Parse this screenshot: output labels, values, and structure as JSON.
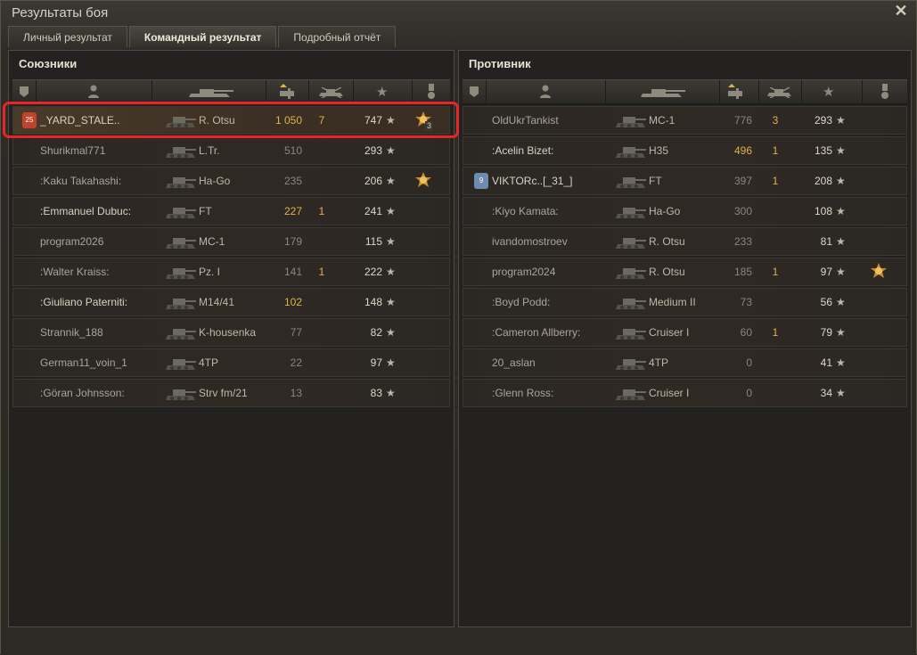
{
  "window": {
    "title": "Результаты боя"
  },
  "tabs": [
    {
      "label": "Личный результат"
    },
    {
      "label": "Командный результат"
    },
    {
      "label": "Подробный отчёт"
    }
  ],
  "allies": {
    "title": "Союзники",
    "rows": [
      {
        "name": "_YARD_STALE..",
        "clan_badge": "25",
        "vehicle": "R. Otsu",
        "damage": "1 050",
        "kills": "7",
        "xp": "747",
        "medal": true,
        "medal_count": "3",
        "self": true,
        "alive": true
      },
      {
        "name": "Shurikmal771",
        "vehicle": "L.Tr.",
        "damage": "510",
        "kills": "",
        "xp": "293",
        "medal": false,
        "alive": false
      },
      {
        "name": ":Kaku Takahashi:",
        "vehicle": "Ha-Go",
        "damage": "235",
        "kills": "",
        "xp": "206",
        "medal": true,
        "alive": false
      },
      {
        "name": ":Emmanuel Dubuc:",
        "vehicle": "FT",
        "damage": "227",
        "kills": "1",
        "xp": "241",
        "medal": false,
        "alive": true,
        "dmg_hi": true
      },
      {
        "name": "program2026",
        "vehicle": "MC-1",
        "damage": "179",
        "kills": "",
        "xp": "115",
        "medal": false,
        "alive": false
      },
      {
        "name": ":Walter Kraiss:",
        "vehicle": "Pz. I",
        "damage": "141",
        "kills": "1",
        "xp": "222",
        "medal": false,
        "alive": false
      },
      {
        "name": ":Giuliano Paterniti:",
        "vehicle": "M14/41",
        "damage": "102",
        "kills": "",
        "xp": "148",
        "medal": false,
        "alive": true,
        "dmg_hi": true
      },
      {
        "name": "Strannik_188",
        "vehicle": "K-housenka",
        "damage": "77",
        "kills": "",
        "xp": "82",
        "medal": false,
        "alive": false
      },
      {
        "name": "German11_voin_1",
        "vehicle": "4TP",
        "damage": "22",
        "kills": "",
        "xp": "97",
        "medal": false,
        "alive": false
      },
      {
        "name": ":Göran Johnsson:",
        "vehicle": "Strv fm/21",
        "damage": "13",
        "kills": "",
        "xp": "83",
        "medal": false,
        "alive": false
      }
    ]
  },
  "enemies": {
    "title": "Противник",
    "rows": [
      {
        "name": "OldUkrTankist",
        "vehicle": "MC-1",
        "damage": "776",
        "kills": "3",
        "xp": "293",
        "medal": false,
        "alive": false
      },
      {
        "name": ":Acelin Bizet:",
        "vehicle": "H35",
        "damage": "496",
        "kills": "1",
        "xp": "135",
        "medal": false,
        "alive": true,
        "dmg_hi": true
      },
      {
        "name": "VIKTORc..[_31_]",
        "clan_badge": "9",
        "vehicle": "FT",
        "damage": "397",
        "kills": "1",
        "xp": "208",
        "medal": false,
        "alive": true
      },
      {
        "name": ":Kiyo Kamata:",
        "vehicle": "Ha-Go",
        "damage": "300",
        "kills": "",
        "xp": "108",
        "medal": false,
        "alive": false
      },
      {
        "name": "ivandomostroev",
        "vehicle": "R. Otsu",
        "damage": "233",
        "kills": "",
        "xp": "81",
        "medal": false,
        "alive": false
      },
      {
        "name": "program2024",
        "vehicle": "R. Otsu",
        "damage": "185",
        "kills": "1",
        "xp": "97",
        "medal": true,
        "alive": false
      },
      {
        "name": ":Boyd Podd:",
        "vehicle": "Medium II",
        "damage": "73",
        "kills": "",
        "xp": "56",
        "medal": false,
        "alive": false
      },
      {
        "name": ":Cameron Allberry:",
        "vehicle": "Cruiser I",
        "damage": "60",
        "kills": "1",
        "xp": "79",
        "medal": false,
        "alive": false
      },
      {
        "name": "20_aslan",
        "vehicle": "4TP",
        "damage": "0",
        "kills": "",
        "xp": "41",
        "medal": false,
        "alive": false
      },
      {
        "name": ":Glenn Ross:",
        "vehicle": "Cruiser I",
        "damage": "0",
        "kills": "",
        "xp": "34",
        "medal": false,
        "alive": false
      }
    ]
  },
  "icons": {
    "star": "★",
    "close": "✕"
  },
  "colors": {
    "highlight": "#e8262a",
    "damage_high": "#e0b24a"
  }
}
